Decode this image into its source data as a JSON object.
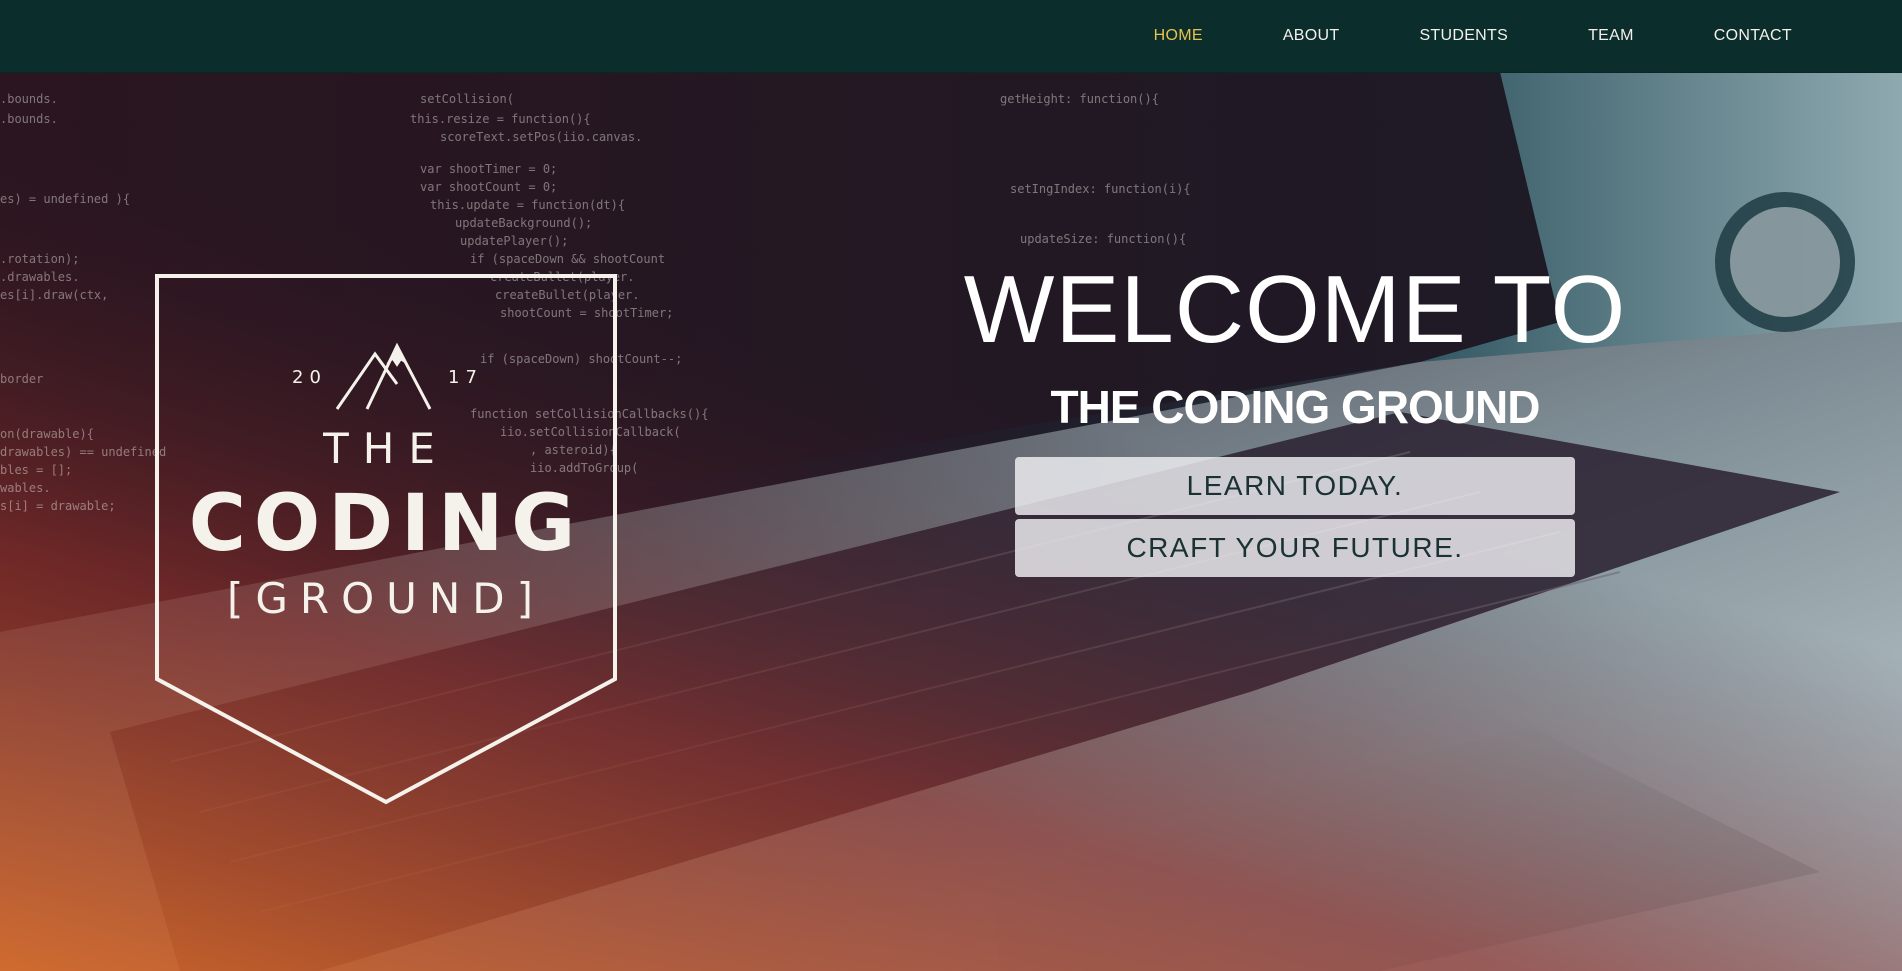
{
  "nav": {
    "items": [
      {
        "label": "HOME",
        "active": true
      },
      {
        "label": "ABOUT",
        "active": false
      },
      {
        "label": "STUDENTS",
        "active": false
      },
      {
        "label": "TEAM",
        "active": false
      },
      {
        "label": "CONTACT",
        "active": false
      }
    ]
  },
  "logo": {
    "year_left": "20",
    "year_right": "17",
    "line1": "THE",
    "line2": "CODING",
    "line3": "[GROUND]"
  },
  "hero": {
    "welcome": "WELCOME TO",
    "subtitle": "THE CODING GROUND",
    "cta_one": "LEARN TODAY.",
    "cta_two": "CRAFT YOUR FUTURE."
  },
  "colors": {
    "topbar": "#0b2d2c",
    "nav_active": "#e6c24e",
    "nav_text": "#f4f1ea",
    "cta_bg": "#f0f0f4",
    "cta_text": "#1a3234"
  }
}
